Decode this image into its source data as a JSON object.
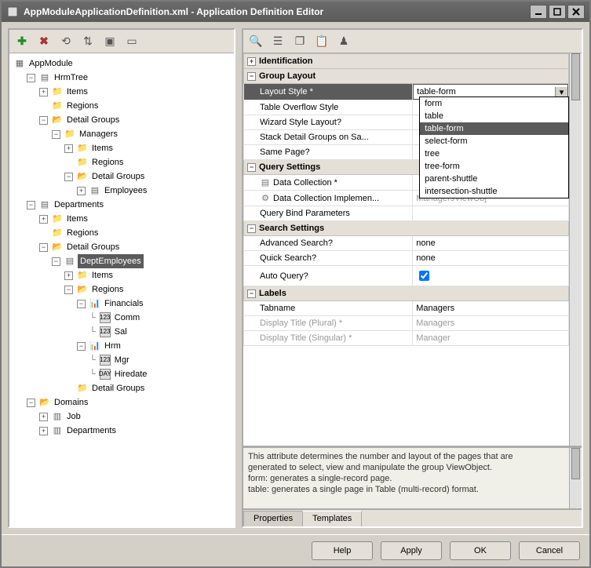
{
  "window": {
    "title": "AppModuleApplicationDefinition.xml - Application Definition Editor"
  },
  "tree": {
    "root": "AppModule",
    "n1": "HrmTree",
    "n1_items": "Items",
    "n1_regions": "Regions",
    "n1_dg": "Detail Groups",
    "n1_mgr": "Managers",
    "n1_mgr_items": "Items",
    "n1_mgr_regions": "Regions",
    "n1_mgr_dg": "Detail Groups",
    "n1_mgr_emp": "Employees",
    "n2": "Departments",
    "n2_items": "Items",
    "n2_regions": "Regions",
    "n2_dg": "Detail Groups",
    "n2_de": "DeptEmployees",
    "n2_de_items": "Items",
    "n2_de_regions": "Regions",
    "n2_de_fin": "Financials",
    "n2_de_comm": "Comm",
    "n2_de_sal": "Sal",
    "n2_de_hrm": "Hrm",
    "n2_de_mgr": "Mgr",
    "n2_de_hire": "Hiredate",
    "n2_de_dg": "Detail Groups",
    "n3": "Domains",
    "n3_job": "Job",
    "n3_dept": "Departments"
  },
  "categories": {
    "identification": "Identification",
    "group_layout": "Group Layout",
    "query_settings": "Query Settings",
    "search_settings": "Search Settings",
    "labels": "Labels"
  },
  "props": {
    "layout_style": "Layout Style *",
    "layout_style_val": "table-form",
    "table_overflow": "Table Overflow Style",
    "wizard_style": "Wizard Style Layout?",
    "stack_detail": "Stack Detail Groups on Sa...",
    "same_page": "Same Page?",
    "data_collection": "Data Collection *",
    "data_coll_impl": "Data Collection Implemen...",
    "data_coll_impl_val": "ManagersViewObj",
    "query_bind": "Query Bind Parameters",
    "adv_search": "Advanced Search?",
    "adv_search_val": "none",
    "quick_search": "Quick Search?",
    "quick_search_val": "none",
    "auto_query": "Auto Query?",
    "tabname": "Tabname",
    "tabname_val": "Managers",
    "display_plural": "Display Title (Plural) *",
    "display_plural_val": "Managers",
    "display_singular": "Display Title (Singular) *",
    "display_singular_val": "Manager"
  },
  "dropdown": {
    "o0": "form",
    "o1": "table",
    "o2": "table-form",
    "o3": "select-form",
    "o4": "tree",
    "o5": "tree-form",
    "o6": "parent-shuttle",
    "o7": "intersection-shuttle"
  },
  "desc": {
    "l1": "This attribute determines the number and layout of the pages that are",
    "l2": "generated to select, view and manipulate the group ViewObject.",
    "l3": "form: generates a single-record page.",
    "l4": "table: generates a single page in Table (multi-record) format."
  },
  "tabs": {
    "properties": "Properties",
    "templates": "Templates"
  },
  "buttons": {
    "help": "Help",
    "apply": "Apply",
    "ok": "OK",
    "cancel": "Cancel"
  }
}
